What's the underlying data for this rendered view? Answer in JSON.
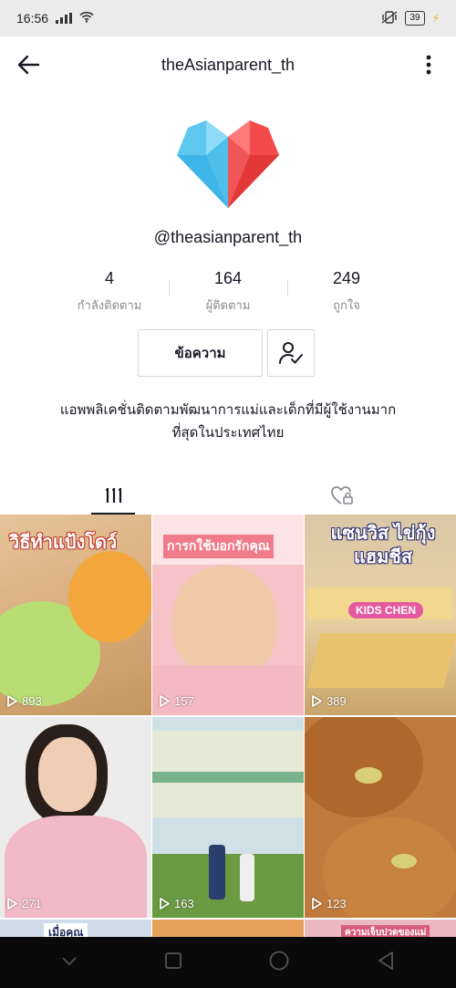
{
  "status_bar": {
    "time": "16:56",
    "battery": "39"
  },
  "header": {
    "title": "theAsianparent_th"
  },
  "profile": {
    "handle": "@theasianparent_th"
  },
  "stats": [
    {
      "value": "4",
      "label": "กำลังติดตาม"
    },
    {
      "value": "164",
      "label": "ผู้ติดตาม"
    },
    {
      "value": "249",
      "label": "ถูกใจ"
    }
  ],
  "actions": {
    "message_label": "ข้อความ"
  },
  "bio": {
    "line1": "แอพพลิเคชั่นติดตามพัฒนาการแม่และเด็กที่มีผู้ใช้งานมาก",
    "line2": "ที่สุดในประเทศไทย"
  },
  "videos": [
    {
      "views": "893",
      "caption": "วิธีทำแป้งโดว์"
    },
    {
      "views": "157",
      "caption": "การกใช้บอกรักคุณ"
    },
    {
      "views": "389",
      "caption": "แซนวิส ไข่กุ้งแฮมชีส",
      "badge": "KIDS CHEN"
    },
    {
      "views": "271"
    },
    {
      "views": "163"
    },
    {
      "views": "123"
    },
    {
      "caption": "เมื่อคุณ"
    },
    {},
    {
      "caption": "ความเจ็บปวดของแม่"
    }
  ]
}
